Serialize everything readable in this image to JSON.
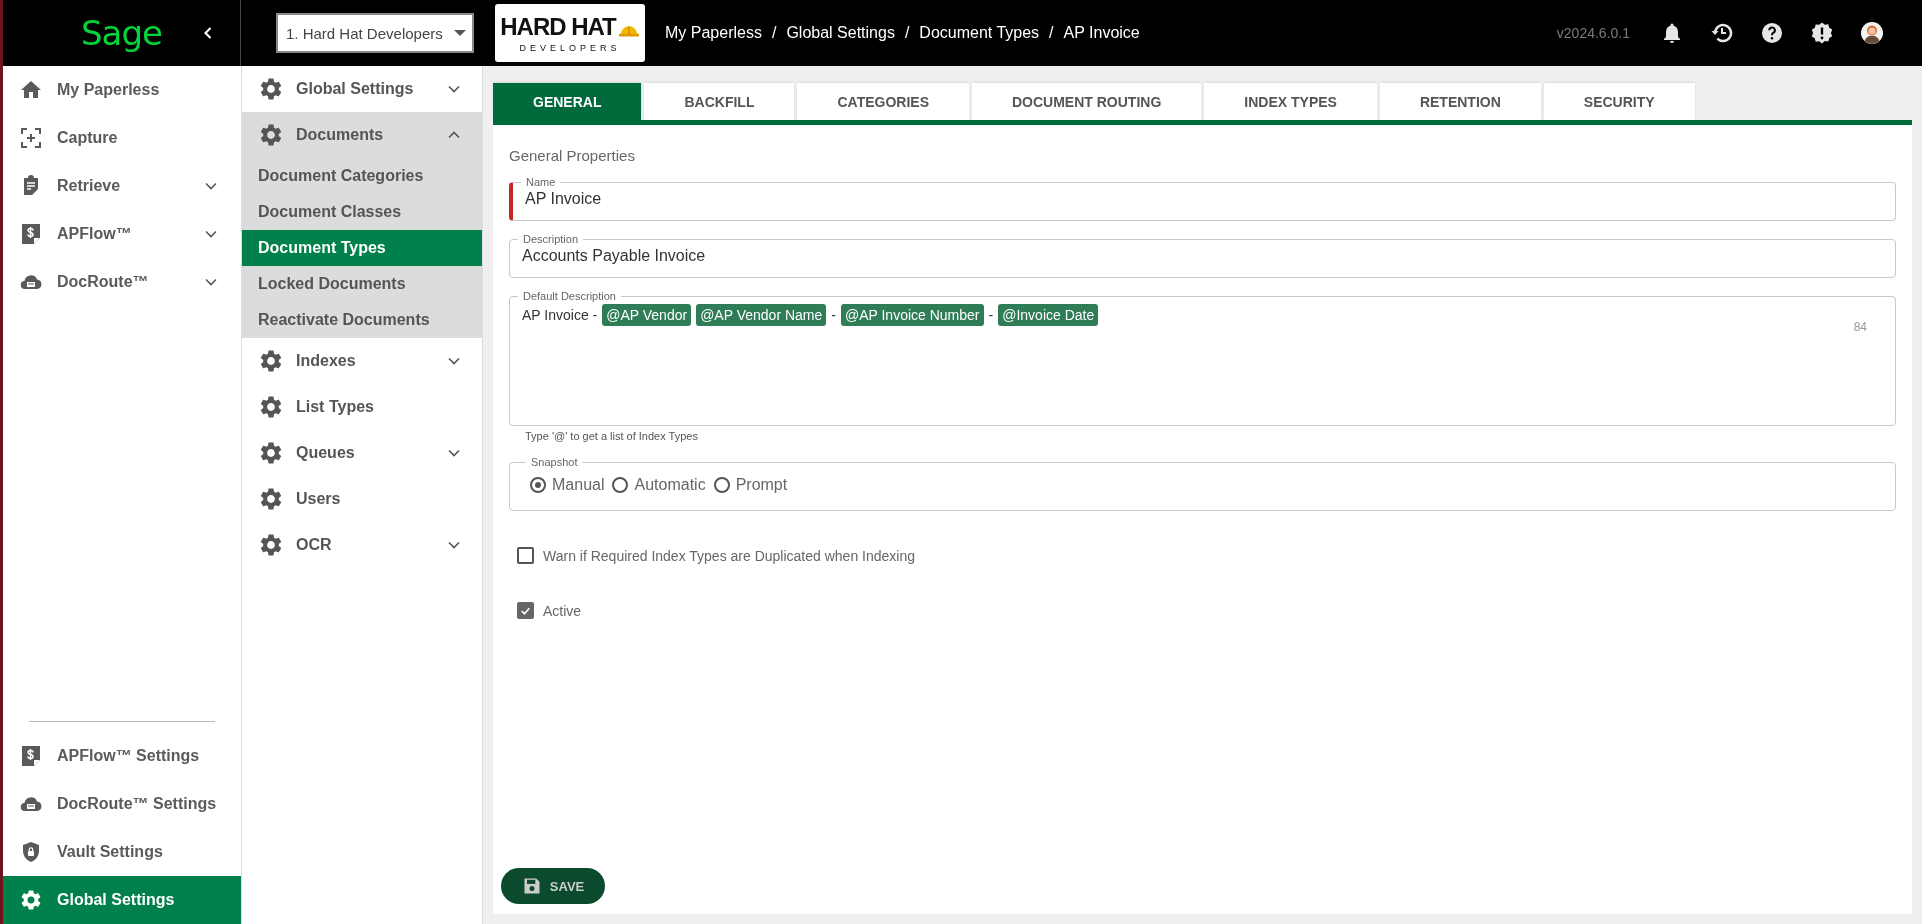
{
  "top_bar": {
    "logo_text": "Sage",
    "company_select": {
      "value": "1. Hard Hat Developers"
    },
    "company_logo": {
      "title": "HARD HAT",
      "subtitle": "DEVELOPERS"
    },
    "breadcrumb": [
      {
        "text": "My Paperless",
        "separator": "/"
      },
      {
        "text": "Global Settings",
        "separator": "/"
      },
      {
        "text": "Document Types",
        "separator": "/"
      },
      {
        "text": "AP Invoice"
      }
    ],
    "version": "v2024.6.0.1"
  },
  "sidebar": {
    "items": [
      {
        "label": "My Paperless",
        "expandable": false,
        "selected": false
      },
      {
        "label": "Capture",
        "expandable": false,
        "selected": false
      },
      {
        "label": "Retrieve",
        "expandable": true,
        "selected": false
      },
      {
        "label": "APFlow™",
        "expandable": true,
        "selected": false
      },
      {
        "label": "DocRoute™",
        "expandable": true,
        "selected": false
      }
    ],
    "bottom_items": [
      {
        "label": "APFlow™ Settings",
        "expandable": false,
        "selected": false
      },
      {
        "label": "DocRoute™ Settings",
        "expandable": false,
        "selected": false
      },
      {
        "label": "Vault Settings",
        "expandable": false,
        "selected": false
      },
      {
        "label": "Global Settings",
        "expandable": false,
        "selected": true
      }
    ]
  },
  "settings_menu": {
    "items": [
      {
        "label": "Global Settings",
        "expandable": true,
        "expanded": false
      },
      {
        "label": "Documents",
        "expandable": true,
        "expanded": true,
        "children": [
          {
            "label": "Document Categories",
            "selected": false
          },
          {
            "label": "Document Classes",
            "selected": false
          },
          {
            "label": "Document Types",
            "selected": true
          },
          {
            "label": "Locked Documents",
            "selected": false
          },
          {
            "label": "Reactivate Documents",
            "selected": false
          }
        ]
      },
      {
        "label": "Indexes",
        "expandable": true,
        "expanded": false
      },
      {
        "label": "List Types",
        "expandable": false,
        "expanded": false
      },
      {
        "label": "Queues",
        "expandable": true,
        "expanded": false
      },
      {
        "label": "Users",
        "expandable": false,
        "expanded": false
      },
      {
        "label": "OCR",
        "expandable": true,
        "expanded": false
      }
    ]
  },
  "tabs": [
    {
      "label": "GENERAL",
      "selected": true
    },
    {
      "label": "BACKFILL",
      "selected": false
    },
    {
      "label": "CATEGORIES",
      "selected": false
    },
    {
      "label": "DOCUMENT ROUTING",
      "selected": false
    },
    {
      "label": "INDEX TYPES",
      "selected": false
    },
    {
      "label": "RETENTION",
      "selected": false
    },
    {
      "label": "SECURITY",
      "selected": false
    }
  ],
  "form": {
    "section_title": "General Properties",
    "name": {
      "label": "Name",
      "value": "AP Invoice",
      "required": true
    },
    "description": {
      "label": "Description",
      "value": "Accounts Payable Invoice",
      "required": false
    },
    "default_description": {
      "label": "Default Description",
      "segments": [
        {
          "kind": "text",
          "text": "AP Invoice -"
        },
        {
          "kind": "chip",
          "text": "@AP Vendor"
        },
        {
          "kind": "chip",
          "text": "@AP Vendor Name"
        },
        {
          "kind": "text",
          "text": "-"
        },
        {
          "kind": "chip",
          "text": "@AP Invoice Number"
        },
        {
          "kind": "text",
          "text": "-"
        },
        {
          "kind": "chip",
          "text": "@Invoice Date"
        }
      ],
      "counter": "84",
      "hint": "Type '@' to get a list of Index Types"
    },
    "snapshot": {
      "label": "Snapshot",
      "options": [
        {
          "label": "Manual",
          "selected": true
        },
        {
          "label": "Automatic",
          "selected": false
        },
        {
          "label": "Prompt",
          "selected": false
        }
      ]
    },
    "checkboxes": [
      {
        "label": "Warn if Required Index Types are Duplicated when Indexing",
        "checked": false
      },
      {
        "label": "Active",
        "checked": true
      }
    ],
    "save_button": "SAVE"
  }
}
